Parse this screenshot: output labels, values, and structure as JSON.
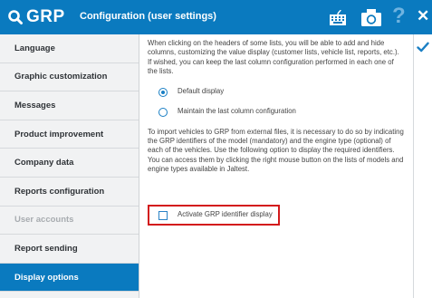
{
  "header": {
    "logo_text": "GRP",
    "title": "Configuration (user settings)",
    "icons": [
      "keyboard-icon",
      "camera-icon",
      "help-icon",
      "close-icon"
    ],
    "help_glyph": "?",
    "close_glyph": "✕",
    "colors": {
      "bar": "#0a7abf",
      "help": "#6fb3e0"
    }
  },
  "sidebar": {
    "items": [
      {
        "label": "Language",
        "state": "normal"
      },
      {
        "label": "Graphic customization",
        "state": "normal"
      },
      {
        "label": "Messages",
        "state": "normal"
      },
      {
        "label": "Product improvement",
        "state": "normal"
      },
      {
        "label": "Company data",
        "state": "normal"
      },
      {
        "label": "Reports configuration",
        "state": "normal"
      },
      {
        "label": "User accounts",
        "state": "disabled"
      },
      {
        "label": "Report sending",
        "state": "normal"
      },
      {
        "label": "Display options",
        "state": "active"
      }
    ]
  },
  "content": {
    "intro": "When clicking on the headers of some lists, you will be able to add and hide columns, customizing the value display (customer lists, vehicle list, reports, etc.). If wished, you can keep the last column configuration performed in each one of the lists.",
    "radio_default": "Default display",
    "radio_maintain": "Maintain the last column configuration",
    "import_text": "To import vehicles to GRP from external files, it is necessary to do so by indicating the GRP identifiers of the model (mandatory) and the engine type (optional) of each of the vehicles. Use the following option to display the required identifiers. You can access them by clicking the right mouse button on the lists of models and engine types available in Jaltest.",
    "checkbox_label": "Activate GRP identifier display",
    "checkbox_checked": false,
    "selected_radio": "default"
  },
  "right_panel": {
    "confirm_icon": "checkmark-icon"
  }
}
